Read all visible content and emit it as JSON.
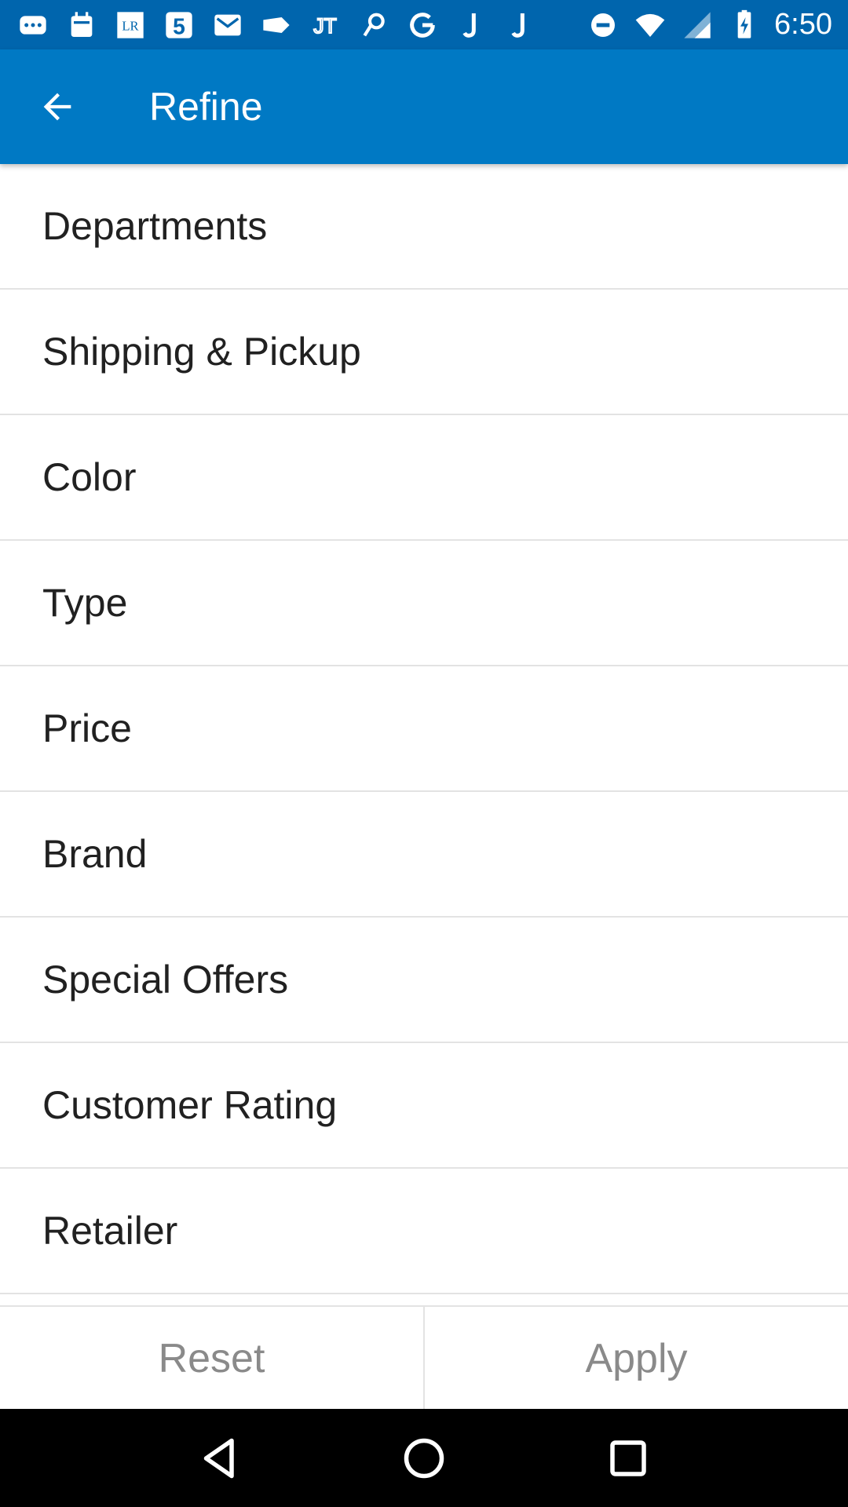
{
  "status_bar": {
    "time": "6:50",
    "notification_icons": [
      "messages-icon",
      "calendar-icon",
      "lr-app-icon",
      "five-app-icon",
      "gmail-icon",
      "tag-icon",
      "jt-app-icon",
      "link-app-icon",
      "google-icon",
      "j-app-icon",
      "j-app-icon-2"
    ],
    "system_icons": [
      "do-not-disturb-icon",
      "wifi-icon",
      "signal-icon",
      "battery-charging-icon"
    ]
  },
  "app_bar": {
    "title": "Refine",
    "back_icon": "arrow-back-icon",
    "background": "#0079C4"
  },
  "filters": [
    {
      "label": "Departments"
    },
    {
      "label": "Shipping & Pickup"
    },
    {
      "label": "Color"
    },
    {
      "label": "Type"
    },
    {
      "label": "Price"
    },
    {
      "label": "Brand"
    },
    {
      "label": "Special Offers"
    },
    {
      "label": "Customer Rating"
    },
    {
      "label": "Retailer"
    }
  ],
  "actions": {
    "reset_label": "Reset",
    "apply_label": "Apply"
  },
  "nav_bar": {
    "icons": [
      "back-triangle-icon",
      "home-circle-icon",
      "recents-square-icon"
    ]
  }
}
